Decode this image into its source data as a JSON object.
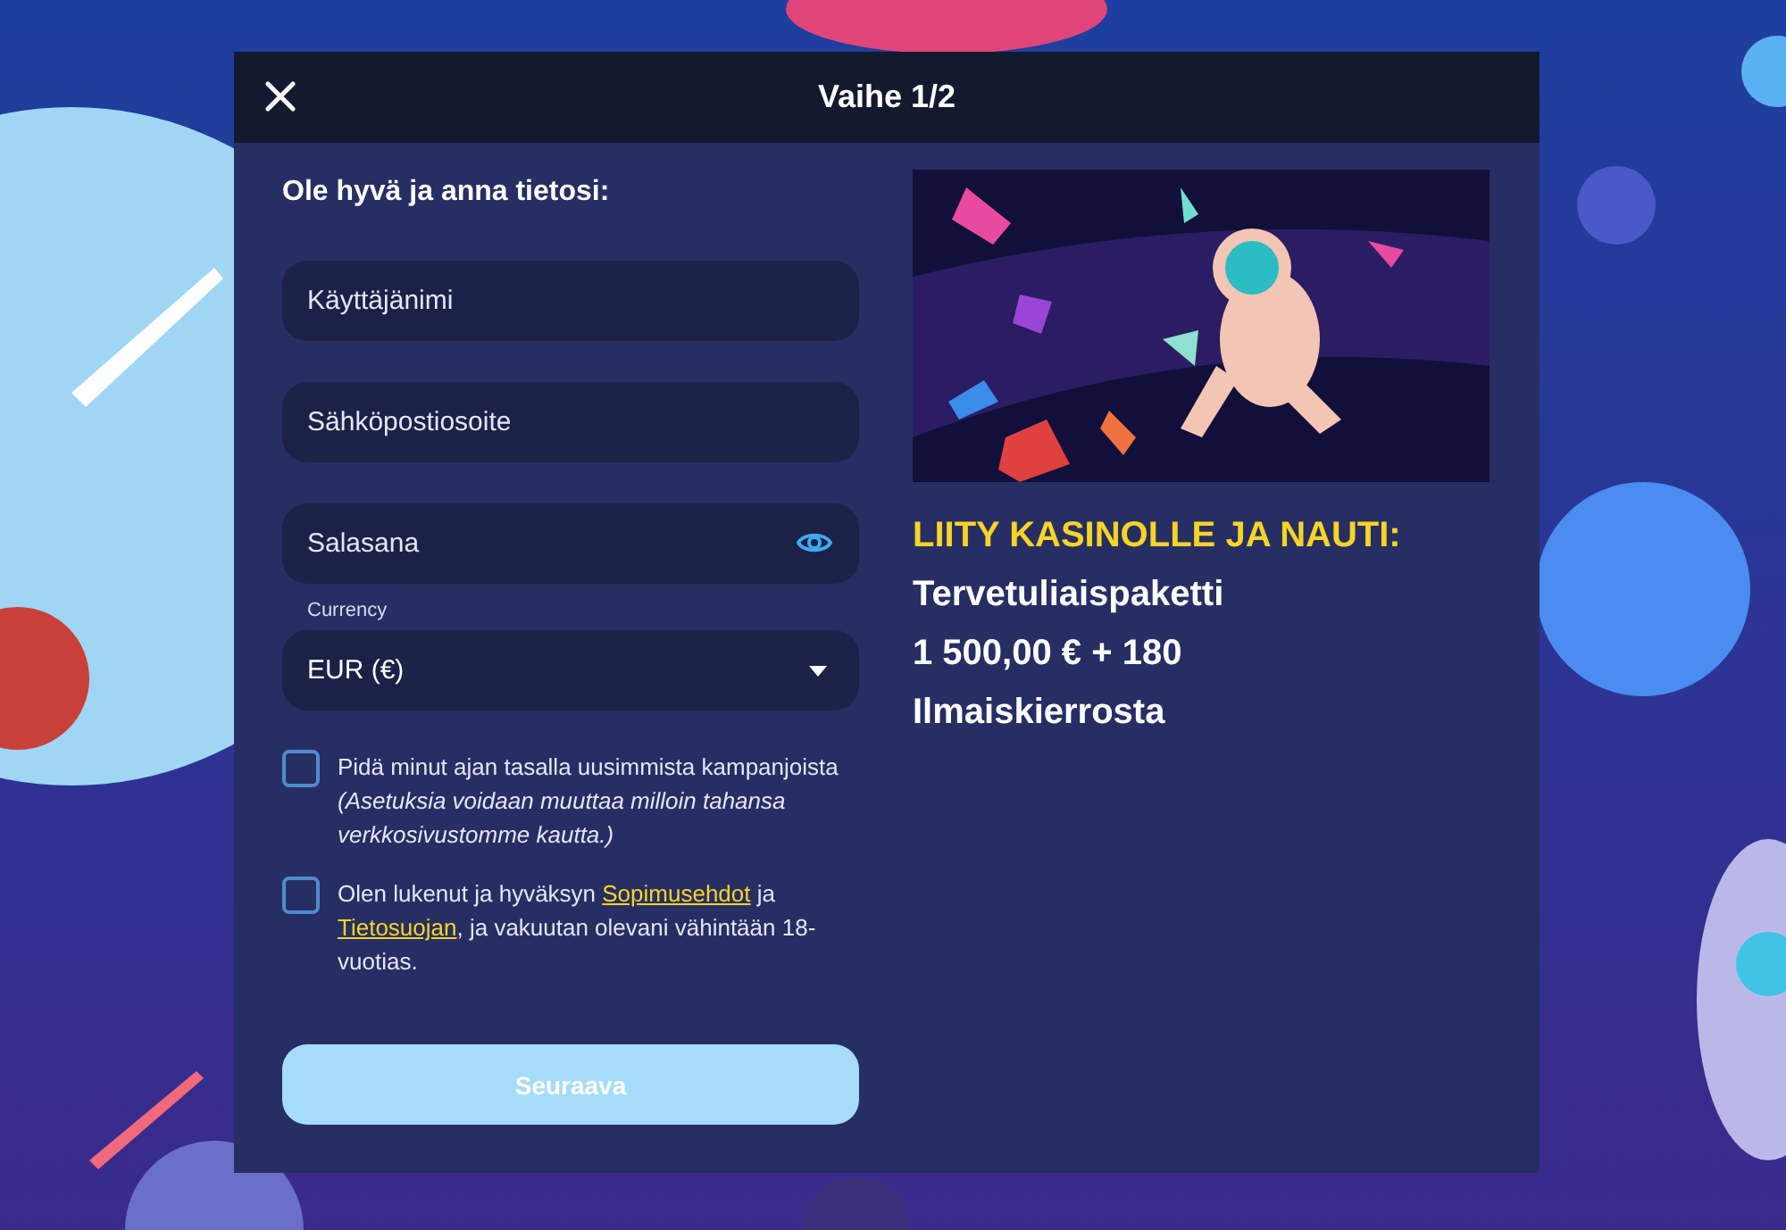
{
  "dialog": {
    "title": "Vaihe 1/2"
  },
  "form": {
    "heading": "Ole hyvä ja anna tietosi:",
    "fields": [
      {
        "kind": "text",
        "placeholder": "Käyttäjänimi"
      },
      {
        "kind": "text",
        "placeholder": "Sähköpostiosoite"
      },
      {
        "kind": "password",
        "placeholder": "Salasana"
      },
      {
        "kind": "select",
        "label": "Currency",
        "value": "EUR (€)"
      }
    ],
    "checkboxes": [
      {
        "checked": false,
        "parts": [
          {
            "text": "Pidä minut ajan tasalla uusimmista kampanjoista"
          }
        ],
        "note": "(Asetuksia voidaan muuttaa milloin tahansa verkkosivustomme kautta.)"
      },
      {
        "checked": false,
        "parts": [
          {
            "text": "Olen lukenut ja hyväksyn "
          },
          {
            "link": "Sopimusehdot"
          },
          {
            "text": " ja "
          },
          {
            "link": "Tietosuojan"
          },
          {
            "text": ", ja vakuutan olevani vähintään 18-vuotias."
          }
        ]
      }
    ],
    "button": {
      "label": "Seuraava",
      "disabled": true
    }
  },
  "promo": {
    "headline": "LIITY KASINOLLE JA NAUTI:",
    "lines": [
      "Tervetuliaispaketti",
      "1 500,00 € + 180",
      "Ilmaiskierrosta"
    ]
  }
}
